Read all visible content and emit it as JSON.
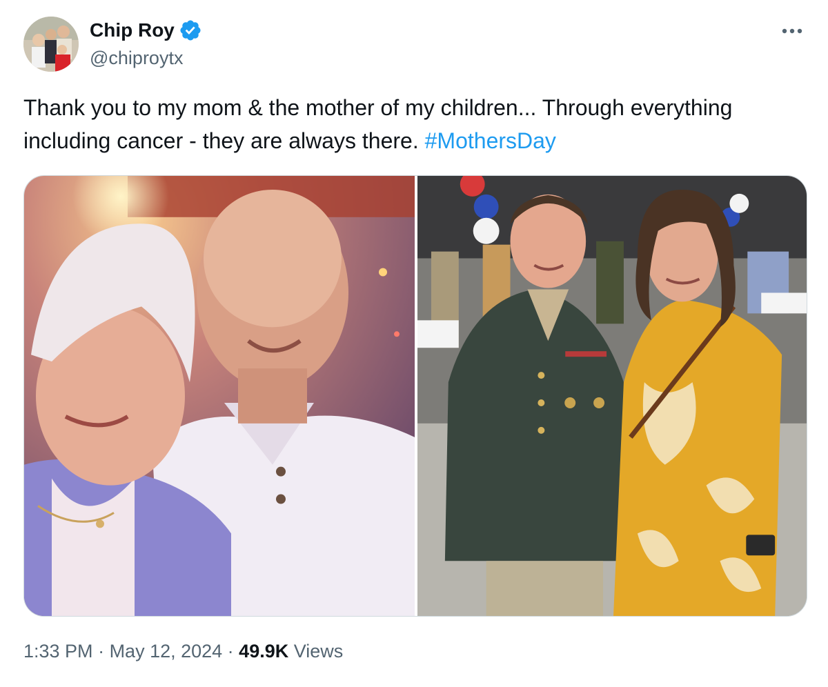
{
  "author": {
    "display_name": "Chip Roy",
    "handle": "@chiproytx",
    "verified": true,
    "verified_color": "#1d9bf0"
  },
  "tweet": {
    "text_part1": "Thank you to my mom & the mother of my children...  Through everything including cancer - they are always there.  ",
    "hashtag": "#MothersDay",
    "media": [
      {
        "alt": "photo-mother-and-son"
      },
      {
        "alt": "photo-wife-and-son-in-uniform"
      }
    ]
  },
  "meta": {
    "time": "1:33 PM",
    "separator": " · ",
    "date": "May 12, 2024",
    "views_count": "49.9K",
    "views_label": " Views"
  },
  "colors": {
    "text": "#0f1419",
    "secondary": "#536471",
    "link": "#1d9bf0",
    "border": "#cfd9de"
  },
  "icons": {
    "more": "more-horizontal-icon",
    "verified": "verified-badge-icon"
  }
}
